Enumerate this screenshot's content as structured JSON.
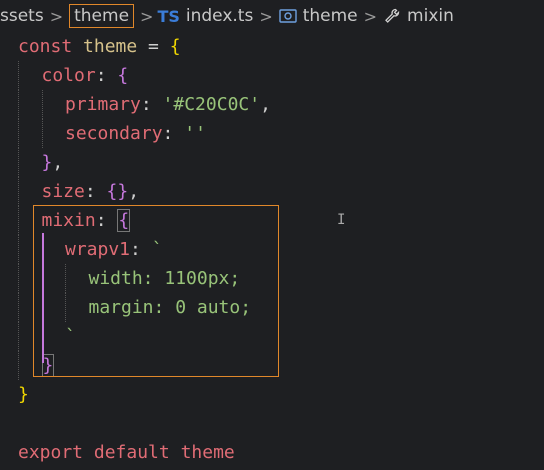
{
  "breadcrumb": {
    "part1": "ssets",
    "part2": "theme",
    "ts_label": "TS",
    "file": "index.ts",
    "symbol1": "theme",
    "symbol2": "mixin"
  },
  "code": {
    "line1_kw": "const",
    "line1_name": "theme",
    "line1_rest": " = ",
    "line1_brace": "{",
    "color_key": "color",
    "primary_key": "primary",
    "primary_val": "'#C20C0C'",
    "secondary_key": "secondary",
    "secondary_val": "''",
    "close_obj": "}",
    "size_key": "size",
    "size_val": "{}",
    "mixin_key": "mixin",
    "wrap_key": "wrapv1",
    "tick": "`",
    "width_line": "width: 1100px;",
    "margin_line": "margin: 0 auto;",
    "export_kw": "export",
    "default_kw": "default",
    "export_name": "theme"
  },
  "colors": {
    "accent_box": "#e0872a",
    "keyword": "#e06c75",
    "string": "#98c379",
    "brace": "#f1d700",
    "guide": "#c678dd"
  }
}
